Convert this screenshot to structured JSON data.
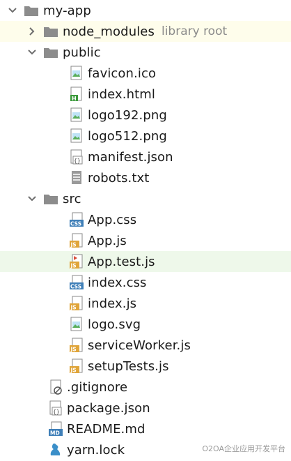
{
  "tree": {
    "root": {
      "label": "my-app",
      "expanded": true
    },
    "node_modules": {
      "label": "node_modules",
      "hint": "library root",
      "expanded": false
    },
    "public": {
      "label": "public",
      "expanded": true
    },
    "public_files": [
      {
        "label": "favicon.ico",
        "icon": "image-file-icon"
      },
      {
        "label": "index.html",
        "icon": "html-file-icon"
      },
      {
        "label": "logo192.png",
        "icon": "image-file-icon"
      },
      {
        "label": "logo512.png",
        "icon": "image-file-icon"
      },
      {
        "label": "manifest.json",
        "icon": "json-file-icon"
      },
      {
        "label": "robots.txt",
        "icon": "text-file-icon"
      }
    ],
    "src": {
      "label": "src",
      "expanded": true
    },
    "src_files": [
      {
        "label": "App.css",
        "icon": "css-file-icon",
        "badge": "CSS"
      },
      {
        "label": "App.js",
        "icon": "js-file-icon",
        "badge": "JS"
      },
      {
        "label": "App.test.js",
        "icon": "test-js-file-icon",
        "badge": "JS"
      },
      {
        "label": "index.css",
        "icon": "css-file-icon",
        "badge": "CSS"
      },
      {
        "label": "index.js",
        "icon": "js-file-icon",
        "badge": "JS"
      },
      {
        "label": "logo.svg",
        "icon": "image-file-icon"
      },
      {
        "label": "serviceWorker.js",
        "icon": "js-file-icon",
        "badge": "JS"
      },
      {
        "label": "setupTests.js",
        "icon": "js-file-icon",
        "badge": "JS"
      }
    ],
    "root_files": [
      {
        "label": ".gitignore",
        "icon": "gitignore-file-icon"
      },
      {
        "label": "package.json",
        "icon": "json-file-icon"
      },
      {
        "label": "README.md",
        "icon": "markdown-file-icon",
        "badge": "MD"
      },
      {
        "label": "yarn.lock",
        "icon": "yarn-file-icon"
      }
    ]
  },
  "watermark": "O2OA企业应用开发平台",
  "colors": {
    "folder": "#8c8c8c",
    "css_badge": "#3f7fb8",
    "js_badge": "#e0a53a",
    "md_badge": "#3f7fb8",
    "html_badge": "#3c9a3c",
    "yarn": "#3b8fc9",
    "row_highlight_yellow": "#fefdeb",
    "row_highlight_green": "#eef8ea"
  }
}
